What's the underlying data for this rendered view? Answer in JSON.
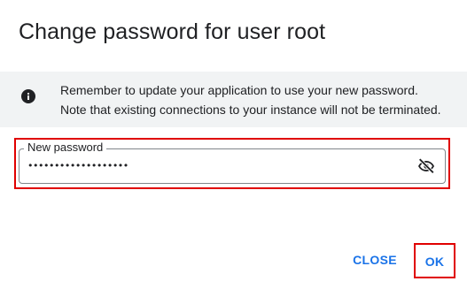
{
  "dialog": {
    "title": "Change password for user root",
    "info": {
      "icon": "info-icon",
      "line1": "Remember to update your application to use your new password.",
      "line2": "Note that existing connections to your instance will not be terminated."
    },
    "password_field": {
      "label": "New password",
      "masked_value": "•••••••••••••••••••",
      "visibility_icon": "visibility-off-icon"
    },
    "actions": {
      "close_label": "CLOSE",
      "ok_label": "OK"
    }
  },
  "colors": {
    "accent": "#1a73e8",
    "highlight": "#e00000",
    "banner_bg": "#f1f3f4",
    "text": "#202124"
  }
}
